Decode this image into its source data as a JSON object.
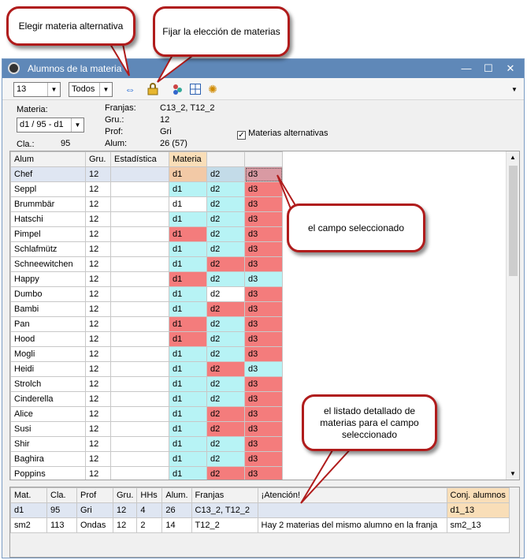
{
  "callouts": {
    "choose_alt": "Elegir materia alternativa",
    "fix_choice": "Fijar la elección de materias",
    "selected_field": "el campo seleccionado",
    "detailed_list": "el listado detallado de materias para el campo seleccionado"
  },
  "window": {
    "title": "Alumnos de la materia",
    "minimize": "—",
    "maximize": "☐",
    "close": "✕"
  },
  "toolbar": {
    "combo1_value": "13",
    "combo2_value": "Todos",
    "arrow_icon": "swap-arrows-icon",
    "lock_icon": "lock-icon"
  },
  "info": {
    "materia_label": "Materia:",
    "materia_value": "d1 / 95 - d1",
    "cla_label": "Cla.:",
    "cla_value": "95",
    "franjas_label": "Franjas:",
    "franjas_value": "C13_2, T12_2",
    "gru_label": "Gru.:",
    "gru_value": "12",
    "prof_label": "Prof:",
    "prof_value": "Gri",
    "alum_label": "Alum:",
    "alum_value": "26 (57)",
    "alt_checkbox_label": "Materias alternativas"
  },
  "grid": {
    "headers": [
      "Alum",
      "Gru.",
      "Estadística",
      "Materia",
      "",
      ""
    ],
    "rows": [
      {
        "name": "Chef",
        "gru": "12",
        "d": [
          "d1",
          "d2",
          "d3"
        ],
        "c": [
          "sel1",
          "sel2",
          "sel3"
        ]
      },
      {
        "name": "Seppl",
        "gru": "12",
        "d": [
          "d1",
          "d2",
          "d3"
        ],
        "c": [
          "cyan",
          "cyan",
          "red"
        ]
      },
      {
        "name": "Brummbär",
        "gru": "12",
        "d": [
          "d1",
          "d2",
          "d3"
        ],
        "c": [
          "white",
          "cyan",
          "red"
        ]
      },
      {
        "name": "Hatschi",
        "gru": "12",
        "d": [
          "d1",
          "d2",
          "d3"
        ],
        "c": [
          "cyan",
          "cyan",
          "red"
        ]
      },
      {
        "name": "Pimpel",
        "gru": "12",
        "d": [
          "d1",
          "d2",
          "d3"
        ],
        "c": [
          "red",
          "cyan",
          "red"
        ]
      },
      {
        "name": "Schlafmütz",
        "gru": "12",
        "d": [
          "d1",
          "d2",
          "d3"
        ],
        "c": [
          "cyan",
          "cyan",
          "red"
        ]
      },
      {
        "name": "Schneewitchen",
        "gru": "12",
        "d": [
          "d1",
          "d2",
          "d3"
        ],
        "c": [
          "cyan",
          "red",
          "red"
        ]
      },
      {
        "name": "Happy",
        "gru": "12",
        "d": [
          "d1",
          "d2",
          "d3"
        ],
        "c": [
          "red",
          "cyan",
          "cyan"
        ]
      },
      {
        "name": "Dumbo",
        "gru": "12",
        "d": [
          "d1",
          "d2",
          "d3"
        ],
        "c": [
          "cyan",
          "white",
          "red"
        ]
      },
      {
        "name": "Bambi",
        "gru": "12",
        "d": [
          "d1",
          "d2",
          "d3"
        ],
        "c": [
          "cyan",
          "red",
          "red"
        ]
      },
      {
        "name": "Pan",
        "gru": "12",
        "d": [
          "d1",
          "d2",
          "d3"
        ],
        "c": [
          "red",
          "cyan",
          "red"
        ]
      },
      {
        "name": "Hood",
        "gru": "12",
        "d": [
          "d1",
          "d2",
          "d3"
        ],
        "c": [
          "red",
          "cyan",
          "red"
        ]
      },
      {
        "name": "Mogli",
        "gru": "12",
        "d": [
          "d1",
          "d2",
          "d3"
        ],
        "c": [
          "cyan",
          "cyan",
          "red"
        ]
      },
      {
        "name": "Heidi",
        "gru": "12",
        "d": [
          "d1",
          "d2",
          "d3"
        ],
        "c": [
          "cyan",
          "red",
          "cyan"
        ]
      },
      {
        "name": "Strolch",
        "gru": "12",
        "d": [
          "d1",
          "d2",
          "d3"
        ],
        "c": [
          "cyan",
          "cyan",
          "red"
        ]
      },
      {
        "name": "Cinderella",
        "gru": "12",
        "d": [
          "d1",
          "d2",
          "d3"
        ],
        "c": [
          "cyan",
          "cyan",
          "red"
        ]
      },
      {
        "name": "Alice",
        "gru": "12",
        "d": [
          "d1",
          "d2",
          "d3"
        ],
        "c": [
          "cyan",
          "red",
          "red"
        ]
      },
      {
        "name": "Susi",
        "gru": "12",
        "d": [
          "d1",
          "d2",
          "d3"
        ],
        "c": [
          "cyan",
          "red",
          "red"
        ]
      },
      {
        "name": "Shir",
        "gru": "12",
        "d": [
          "d1",
          "d2",
          "d3"
        ],
        "c": [
          "cyan",
          "cyan",
          "red"
        ]
      },
      {
        "name": "Baghira",
        "gru": "12",
        "d": [
          "d1",
          "d2",
          "d3"
        ],
        "c": [
          "cyan",
          "cyan",
          "red"
        ]
      },
      {
        "name": "Poppins",
        "gru": "12",
        "d": [
          "d1",
          "d2",
          "d3"
        ],
        "c": [
          "cyan",
          "red",
          "red"
        ]
      }
    ]
  },
  "bottom": {
    "headers": [
      "Mat.",
      "Cla.",
      "Prof",
      "Gru.",
      "HHs",
      "Alum.",
      "Franjas",
      "¡Atención!",
      "Conj. alumnos"
    ],
    "rows": [
      [
        "d1",
        "95",
        "Gri",
        "12",
        "4",
        "26",
        "C13_2, T12_2",
        "",
        "d1_13"
      ],
      [
        "sm2",
        "113",
        "Ondas",
        "12",
        "2",
        "14",
        "T12_2",
        "Hay 2 materias del mismo alumno en la franja",
        "sm2_13"
      ]
    ]
  },
  "colors": {
    "red": "#f47c7c",
    "cyan": "#b7f3f5",
    "sel1": "#f2c9a6",
    "sel2": "#c3dbe8",
    "sel3": "#d99aa3",
    "callout_border": "#b01c1c",
    "titlebar": "#5f88b8"
  }
}
